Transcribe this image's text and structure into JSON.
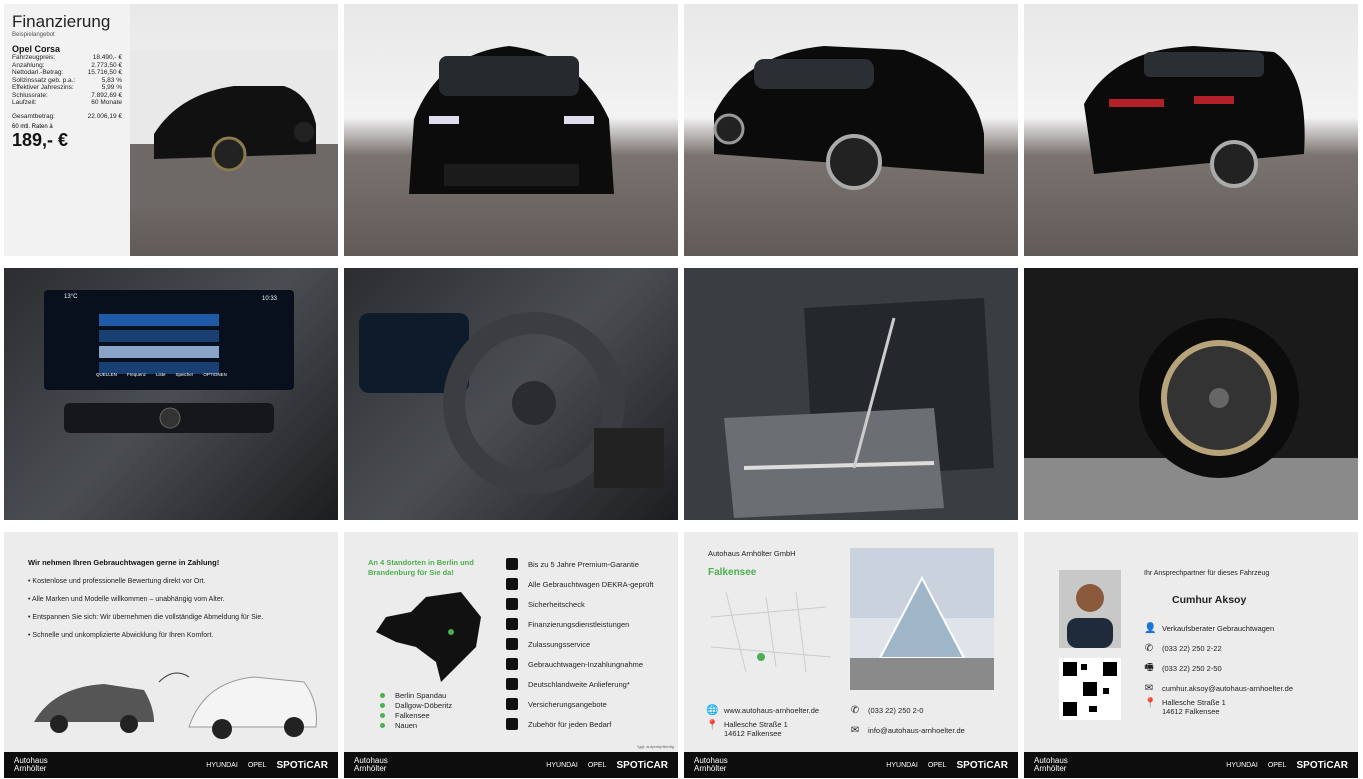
{
  "finance": {
    "title": "Finanzierung",
    "subtitle": "Beispielangebot",
    "model": "Opel Corsa",
    "rows": [
      {
        "label": "Fahrzeugpreis:",
        "value": "18.490,- €"
      },
      {
        "label": "Anzahlung:",
        "value": "2.773,50 €"
      },
      {
        "label": "Nettodarl.-Betrag:",
        "value": "15.716,50 €"
      },
      {
        "label": "Sollzinssatz geb. p.a.:",
        "value": "5,83 %"
      },
      {
        "label": "Effektiver Jahreszins:",
        "value": "5,99 %"
      },
      {
        "label": "Schlussrate:",
        "value": "7.892,69 €"
      },
      {
        "label": "Laufzeit:",
        "value": "60 Monate"
      }
    ],
    "total_label": "Gesamtbetrag:",
    "total_value": "22.006,19 €",
    "rate_label": "60 mtl. Raten à",
    "rate_value": "189,- €"
  },
  "tradein": {
    "heading": "Wir nehmen Ihren Gebrauchtwagen gerne in Zahlung!",
    "bullets": [
      "Kostenlose und professionelle Bewertung direkt vor Ort.",
      "Alle Marken und Modelle willkommen – unabhängig vom Alter.",
      "Entspannen Sie sich: Wir übernehmen die vollständige Abmeldung für Sie.",
      "Schnelle und unkomplizierte Abwicklung für Ihren Komfort."
    ]
  },
  "locations": {
    "heading": "An 4 Standorten in Berlin und Brandenburg für Sie da!",
    "list": [
      "Berlin Spandau",
      "Dallgow-Döberitz",
      "Falkensee",
      "Nauen"
    ],
    "services": [
      "Bis zu 5 Jahre Premium-Garantie",
      "Alle Gebrauchtwagen DEKRA-geprüft",
      "Sicherheitscheck",
      "Finanzierungsdienstleistungen",
      "Zulassungsservice",
      "Gebrauchtwagen-Inzahlungnahme",
      "Deutschlandweite Anlieferung*",
      "Versicherungsangebote",
      "Zubehör für jeden Bedarf"
    ],
    "footnote": "*ggf. aufpreispflichtig"
  },
  "dealer": {
    "name": "Autohaus Arnhölter GmbH",
    "city": "Falkensee",
    "website": "www.autohaus-arnhoelter.de",
    "street": "Hallesche Straße 1",
    "zip_city": "14612 Falkensee",
    "phone": "(033 22) 250 2-0",
    "email": "info@autohaus-arnhoelter.de"
  },
  "contact": {
    "intro": "Ihr Ansprechpartner für dieses Fahrzeug",
    "name": "Cumhur Aksoy",
    "role": "Verkaufsberater Gebrauchtwagen",
    "phone": "(033 22) 250 2-22",
    "fax": "(033 22) 250 2-50",
    "email": "cumhur.aksoy@autohaus-arnhoelter.de",
    "street": "Hallesche Straße 1",
    "zip_city": "14612 Falkensee"
  },
  "footer": {
    "brand_line1": "Autohaus",
    "brand_line2": "Arnhölter",
    "hyundai": "HYUNDAI",
    "opel": "OPEL",
    "spoticar": "SPOTiCAR"
  },
  "infotainment": {
    "temp": "13°C",
    "time": "10:33",
    "menu": [
      "QUELLEN",
      "Frequenz",
      "Liste",
      "Speicher",
      "OPTIONEN"
    ]
  }
}
